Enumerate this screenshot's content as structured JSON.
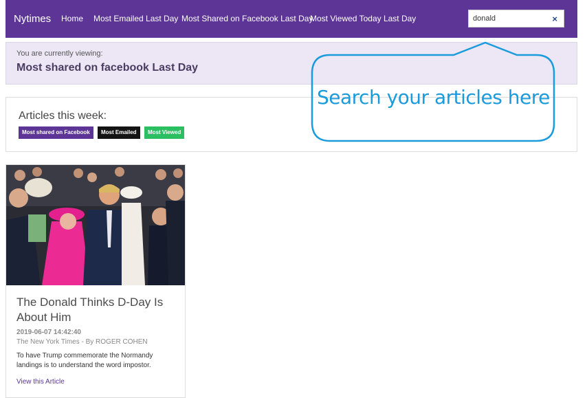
{
  "navbar": {
    "brand": "Nytimes",
    "links": [
      "Home",
      "Most Emailed Last Day",
      "Most Shared on Facebook Last Day",
      "Most Viewed Today Last Day"
    ],
    "search_value": "donald",
    "clear_glyph": "×"
  },
  "viewing": {
    "label": "You are currently viewing:",
    "current": "Most shared on facebook Last Day"
  },
  "articles_week": {
    "heading": "Articles this week:",
    "badges": [
      "Most shared on Facebook",
      "Most Emailed",
      "Most Viewed"
    ]
  },
  "article": {
    "title": "The Donald Thinks D-Day Is About Him",
    "datetime": "2019-06-07 14:42:40",
    "byline": "The New York Times - By ROGER COHEN",
    "description": "To have Trump commemorate the Normandy landings is to understand the word impostor.",
    "link_label": "View this Article"
  },
  "callout": {
    "text": "Search your articles here"
  },
  "colors": {
    "brand_purple": "#5c3596",
    "viewing_bg": "#ece6f5",
    "badge_emailed": "#141414",
    "badge_viewed": "#2bbf62",
    "callout_blue": "#1a9bdc"
  }
}
